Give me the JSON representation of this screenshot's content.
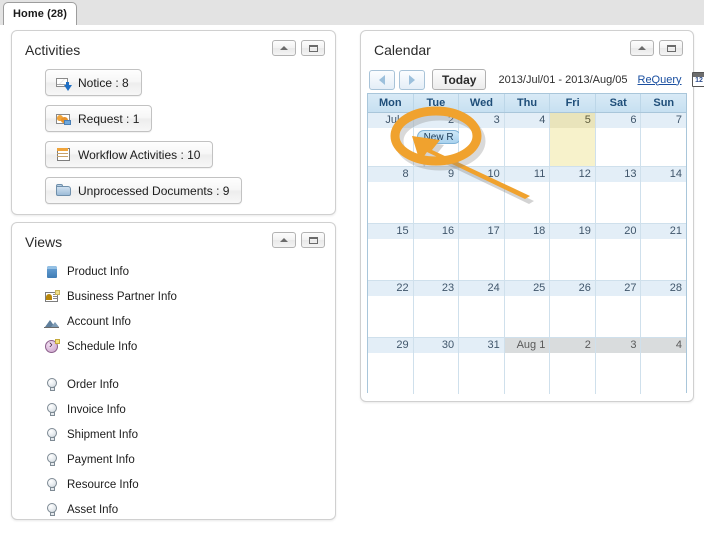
{
  "tab": {
    "label": "Home (28)"
  },
  "activities": {
    "title": "Activities",
    "tools": {
      "collapse": "collapse-icon",
      "maximize": "maximize-icon"
    },
    "buttons": [
      {
        "label": "Notice : 8",
        "icon": "notice-icon"
      },
      {
        "label": "Request : 1",
        "icon": "request-icon"
      },
      {
        "label": "Workflow Activities : 10",
        "icon": "workflow-icon"
      },
      {
        "label": "Unprocessed Documents : 9",
        "icon": "folder-icon"
      }
    ]
  },
  "views": {
    "title": "Views",
    "tools": {
      "collapse": "collapse-icon",
      "maximize": "maximize-icon"
    },
    "items": [
      {
        "label": "Product Info",
        "icon": "product-icon"
      },
      {
        "label": "Business Partner Info",
        "icon": "business-partner-icon"
      },
      {
        "label": "Account Info",
        "icon": "account-chart-icon"
      },
      {
        "label": "Schedule Info",
        "icon": "schedule-icon"
      },
      {
        "label": "Order Info",
        "icon": "bulb-icon"
      },
      {
        "label": "Invoice Info",
        "icon": "bulb-icon"
      },
      {
        "label": "Shipment Info",
        "icon": "bulb-icon"
      },
      {
        "label": "Payment Info",
        "icon": "bulb-icon"
      },
      {
        "label": "Resource Info",
        "icon": "bulb-icon"
      },
      {
        "label": "Asset Info",
        "icon": "bulb-icon"
      }
    ]
  },
  "calendar": {
    "title": "Calendar",
    "tools": {
      "collapse": "collapse-icon",
      "maximize": "maximize-icon"
    },
    "toolbar": {
      "prev": "prev-arrow-icon",
      "next": "next-arrow-icon",
      "today_label": "Today",
      "range": "2013/Jul/01 - 2013/Aug/05",
      "requery_label": "ReQuery",
      "date_picker_icon": "calendar-picker-icon",
      "date_picker_num": "12"
    },
    "weekday_headers": [
      "Mon",
      "Tue",
      "Wed",
      "Thu",
      "Fri",
      "Sat",
      "Sun"
    ],
    "weeks": [
      [
        {
          "num": "Jul 1",
          "type": "normal",
          "events": []
        },
        {
          "num": "2",
          "type": "normal",
          "events": [
            "New R"
          ]
        },
        {
          "num": "3",
          "type": "normal",
          "events": []
        },
        {
          "num": "4",
          "type": "normal",
          "events": []
        },
        {
          "num": "5",
          "type": "today",
          "events": []
        },
        {
          "num": "6",
          "type": "normal",
          "events": []
        },
        {
          "num": "7",
          "type": "normal",
          "events": []
        }
      ],
      [
        {
          "num": "8",
          "type": "normal",
          "events": []
        },
        {
          "num": "9",
          "type": "normal",
          "events": []
        },
        {
          "num": "10",
          "type": "normal",
          "events": []
        },
        {
          "num": "11",
          "type": "normal",
          "events": []
        },
        {
          "num": "12",
          "type": "normal",
          "events": []
        },
        {
          "num": "13",
          "type": "normal",
          "events": []
        },
        {
          "num": "14",
          "type": "normal",
          "events": []
        }
      ],
      [
        {
          "num": "15",
          "type": "normal",
          "events": []
        },
        {
          "num": "16",
          "type": "normal",
          "events": []
        },
        {
          "num": "17",
          "type": "normal",
          "events": []
        },
        {
          "num": "18",
          "type": "normal",
          "events": []
        },
        {
          "num": "19",
          "type": "normal",
          "events": []
        },
        {
          "num": "20",
          "type": "normal",
          "events": []
        },
        {
          "num": "21",
          "type": "normal",
          "events": []
        }
      ],
      [
        {
          "num": "22",
          "type": "normal",
          "events": []
        },
        {
          "num": "23",
          "type": "normal",
          "events": []
        },
        {
          "num": "24",
          "type": "normal",
          "events": []
        },
        {
          "num": "25",
          "type": "normal",
          "events": []
        },
        {
          "num": "26",
          "type": "normal",
          "events": []
        },
        {
          "num": "27",
          "type": "normal",
          "events": []
        },
        {
          "num": "28",
          "type": "normal",
          "events": []
        }
      ],
      [
        {
          "num": "29",
          "type": "normal",
          "events": []
        },
        {
          "num": "30",
          "type": "normal",
          "events": []
        },
        {
          "num": "31",
          "type": "normal",
          "events": []
        },
        {
          "num": "Aug 1",
          "type": "other",
          "events": []
        },
        {
          "num": "2",
          "type": "other",
          "events": []
        },
        {
          "num": "3",
          "type": "other",
          "events": []
        },
        {
          "num": "4",
          "type": "other",
          "events": []
        }
      ]
    ]
  },
  "annotation": {
    "shape": "ellipse-with-arrow",
    "color": "#f0a22e",
    "target": "New R event chip on Jul 2"
  },
  "colors": {
    "accent": "#f0a22e",
    "calendar_header": "#c7e0f1",
    "today_cell": "#f7f2cb",
    "other_month": "#d9dcdd",
    "link": "#1a4fa0"
  }
}
